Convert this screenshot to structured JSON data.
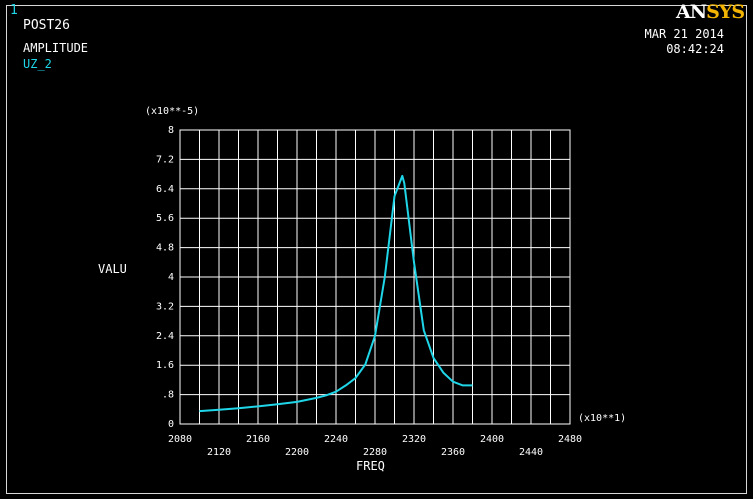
{
  "window_number": "1",
  "module": "POST26",
  "plot_heading": "AMPLITUDE",
  "variable_name": "UZ_2",
  "logo": {
    "part1": "AN",
    "part2": "SYS"
  },
  "date": "MAR 21 2014",
  "time": "08:42:24",
  "colors": {
    "background": "#000000",
    "text": "#ffffff",
    "curve": "#1fd6e8",
    "logo_accent": "#f2b400"
  },
  "chart_data": {
    "type": "line",
    "xlabel": "FREQ",
    "ylabel": "VALU",
    "x_multiplier": "(x10**1)",
    "y_multiplier": "(x10**-5)",
    "xlim": [
      2080,
      2480
    ],
    "ylim": [
      0,
      8
    ],
    "grid": true,
    "x_ticks_upper": [
      "2080",
      "2160",
      "2240",
      "2320",
      "2400",
      "2480"
    ],
    "x_ticks_lower": [
      "2120",
      "2200",
      "2280",
      "2360",
      "2440"
    ],
    "y_ticks": [
      "0",
      ".8",
      "1.6",
      "2.4",
      "3.2",
      "4",
      "4.8",
      "5.6",
      "6.4",
      "7.2",
      "8"
    ],
    "series": [
      {
        "x": [
          2100,
          2120,
          2140,
          2160,
          2180,
          2200,
          2220,
          2230,
          2240,
          2250,
          2260,
          2270,
          2280,
          2290,
          2300,
          2308,
          2310,
          2320,
          2330,
          2340,
          2350,
          2360,
          2370,
          2380
        ],
        "values": [
          0.35,
          0.39,
          0.43,
          0.48,
          0.54,
          0.6,
          0.71,
          0.78,
          0.88,
          1.05,
          1.25,
          1.62,
          2.4,
          4.0,
          6.2,
          6.75,
          6.55,
          4.4,
          2.55,
          1.8,
          1.4,
          1.15,
          1.05,
          1.05
        ]
      }
    ]
  }
}
